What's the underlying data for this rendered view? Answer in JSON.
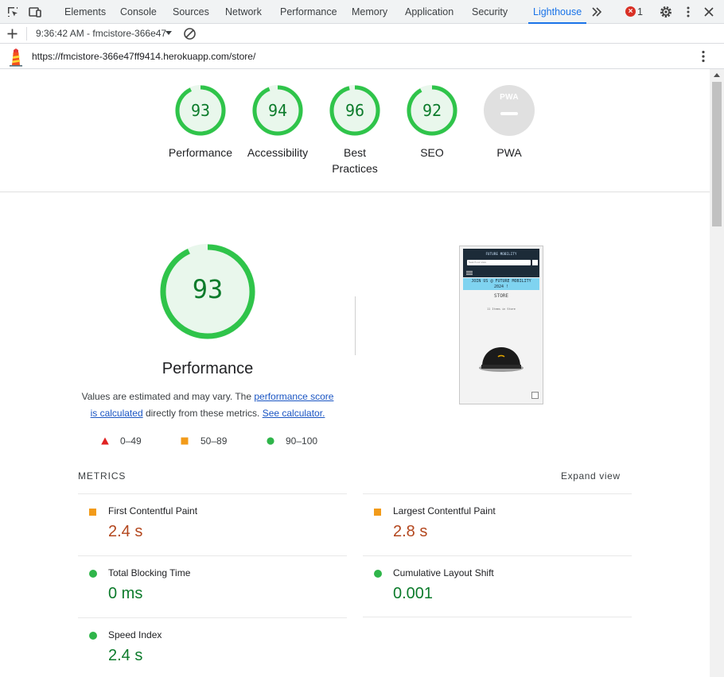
{
  "devtools": {
    "tabs": [
      "Elements",
      "Console",
      "Sources",
      "Network",
      "Performance",
      "Memory",
      "Application",
      "Security",
      "Lighthouse"
    ],
    "active_tab": "Lighthouse",
    "error_count": "1",
    "report_select": "9:36:42 AM - fmcistore-366e47",
    "url": "https://fmcistore-366e47ff9414.herokuapp.com/store/"
  },
  "scores": [
    {
      "label": "Performance",
      "value": "93"
    },
    {
      "label": "Accessibility",
      "value": "94"
    },
    {
      "label": "Best",
      "label2": "Practices",
      "value": "96"
    },
    {
      "label": "SEO",
      "value": "92"
    },
    {
      "label": "PWA",
      "value": "PWA"
    }
  ],
  "score_fractions": [
    0.93,
    0.94,
    0.96,
    0.92
  ],
  "performance": {
    "score": "93",
    "title": "Performance",
    "desc_prefix": "Values are estimated and may vary. The",
    "desc_link1_a": "performance score",
    "desc_link1_b": "is calculated",
    "desc_middle": "directly from these metrics.",
    "desc_link2": "See calculator."
  },
  "legend": [
    "0–49",
    "50–89",
    "90–100"
  ],
  "screenshot": {
    "header_title": "FUTURE MOBILITY",
    "search_placeholder": "Search our store",
    "banner_line1": "JOIN US @ FUTURE MOBILITY",
    "banner_line2": "2024 !",
    "store_label": "STORE",
    "items_count": "11 Items in Store"
  },
  "metrics": {
    "title": "METRICS",
    "expand": "Expand view",
    "items": [
      {
        "name": "First Contentful Paint",
        "value": "2.4 s",
        "rating": "average"
      },
      {
        "name": "Largest Contentful Paint",
        "value": "2.8 s",
        "rating": "average"
      },
      {
        "name": "Total Blocking Time",
        "value": "0 ms",
        "rating": "pass"
      },
      {
        "name": "Cumulative Layout Shift",
        "value": "0.001",
        "rating": "pass"
      },
      {
        "name": "Speed Index",
        "value": "2.4 s",
        "rating": "pass"
      }
    ]
  },
  "colors": {
    "pass": "#0c7b2b",
    "pass_ring": "#2fc44a",
    "pass_fill": "#e9f7ec",
    "average": "#f29b1a",
    "average_text": "#b3471e",
    "fail": "#e02222",
    "accent": "#1a73e8",
    "link": "#1a55c3"
  }
}
